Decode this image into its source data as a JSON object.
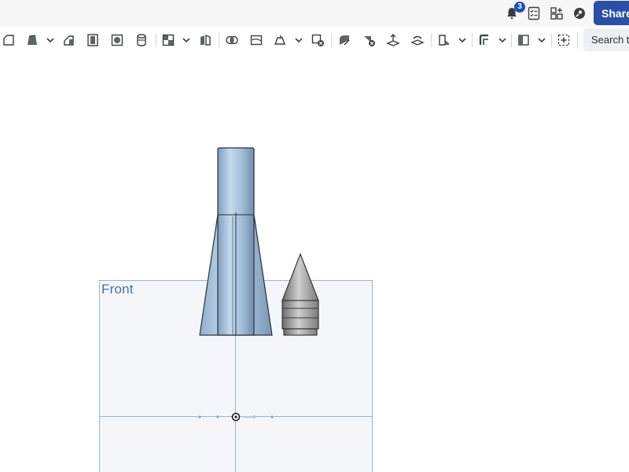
{
  "header": {
    "notifications_count": "3",
    "share_label": "Share",
    "icons": [
      "bell-icon",
      "checklist-icon",
      "apps-grid-icon",
      "learning-center-icon"
    ]
  },
  "toolbar": {
    "search_placeholder": "Search tools",
    "search_visible_text": "Search to",
    "tools": [
      "sketch-icon",
      "extrude-icon",
      "revolve-icon",
      "sweep-icon",
      "loft-icon",
      "thicken-icon",
      "fillet-icon",
      "chamfer-icon",
      "draft-icon",
      "rib-icon",
      "shell-icon",
      "hole-icon",
      "boolean-icon",
      "split-icon",
      "transform-icon",
      "pattern-icon",
      "mirror-icon",
      "delete-part-icon",
      "modify-fillet-icon",
      "move-face-icon",
      "replace-face-icon",
      "plane-icon",
      "helix-icon",
      "sheet-metal-icon",
      "frame-icon",
      "insert-feature-icon"
    ]
  },
  "viewport": {
    "plane_label": "Front"
  },
  "colors": {
    "share_button": "#2b4fa5",
    "badge": "#1f4fb3",
    "plane_border": "#9fb3d1",
    "plane_label": "#4b6fae",
    "body_blue": "#a9c2db",
    "body_gray": "#9a9a9a"
  }
}
